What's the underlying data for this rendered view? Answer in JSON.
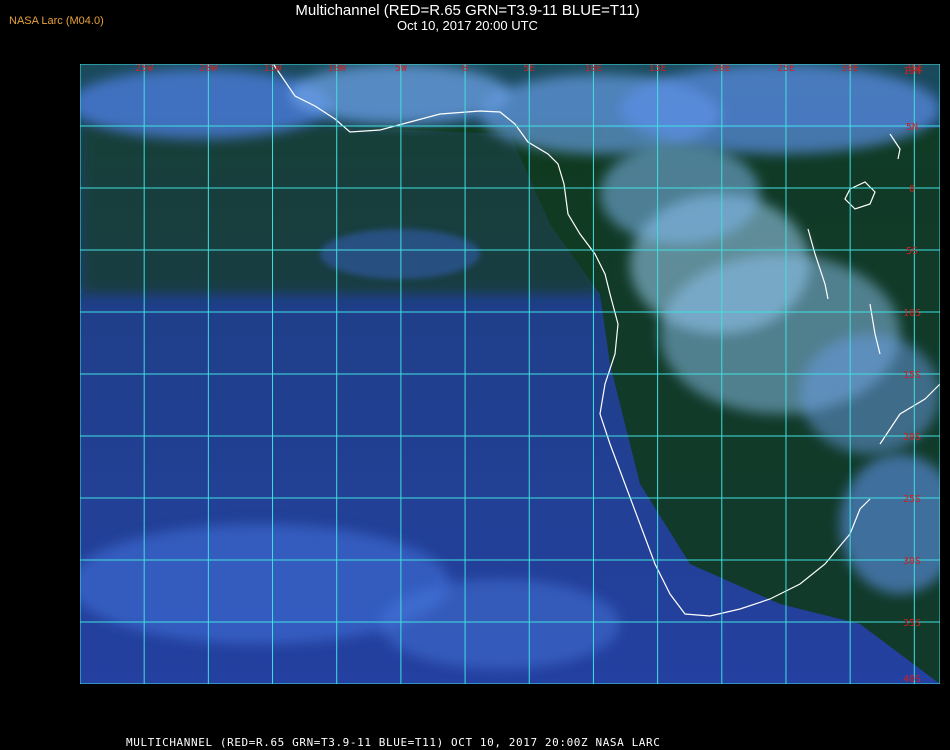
{
  "header": {
    "title": "Multichannel (RED=R.65 GRN=T3.9-11 BLUE=T11)",
    "datetime": "Oct 10, 2017 20:00 UTC",
    "producer": "NASA Larc (M04.0)"
  },
  "footer": {
    "caption": "MULTICHANNEL (RED=R.65 GRN=T3.9-11 BLUE=T11) OCT 10, 2017 20:00Z   NASA LARC"
  },
  "map": {
    "lon_range": [
      -30,
      37
    ],
    "lat_range": [
      -40,
      10
    ],
    "lon_labels": [
      "25W",
      "20W",
      "15W",
      "10W",
      "5W",
      "0",
      "5E",
      "10E",
      "15E",
      "20E",
      "25E",
      "30E",
      "35E"
    ],
    "lon_values": [
      -25,
      -20,
      -15,
      -10,
      -5,
      0,
      5,
      10,
      15,
      20,
      25,
      30,
      35
    ],
    "lat_labels": [
      "10N",
      "5N",
      "0",
      "5S",
      "10S",
      "15S",
      "20S",
      "25S",
      "30S",
      "35S",
      "40S"
    ],
    "lat_values": [
      10,
      5,
      0,
      -5,
      -10,
      -15,
      -20,
      -25,
      -30,
      -35,
      -40
    ],
    "colors": {
      "grid": "#3fe0e0",
      "coast": "#ffffff",
      "label": "#cc2222",
      "ocean": "#1f3d8c",
      "land": "#0e3a1c",
      "cloud": "#5a8fe8",
      "bright_cloud": "#9fd0f5"
    }
  }
}
